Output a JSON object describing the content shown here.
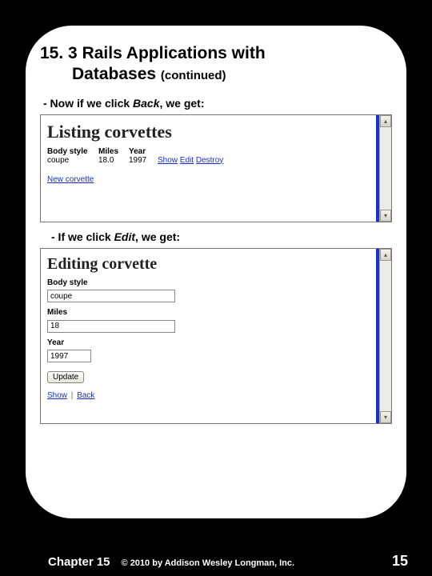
{
  "heading": {
    "section_num": "15. 3",
    "title_rest": "Rails Applications with",
    "title_line2": "Databases",
    "continued": "(continued)"
  },
  "bullet1_pre": "- Now if we click ",
  "bullet1_em": "Back",
  "bullet1_post": ", we get:",
  "bullet2_pre": "- If we click ",
  "bullet2_em": "Edit",
  "bullet2_post": ", we get:",
  "listing": {
    "title": "Listing corvettes",
    "headers": {
      "body_style": "Body style",
      "miles": "Miles",
      "year": "Year"
    },
    "row": {
      "body_style": "coupe",
      "miles": "18.0",
      "year": "1997",
      "show": "Show",
      "edit": "Edit",
      "destroy": "Destroy"
    },
    "new_link": "New corvette"
  },
  "editing": {
    "title": "Editing corvette",
    "labels": {
      "body_style": "Body style",
      "miles": "Miles",
      "year": "Year"
    },
    "values": {
      "body_style": "coupe",
      "miles": "18",
      "year": "1997"
    },
    "update_btn": "Update",
    "show": "Show",
    "back": "Back"
  },
  "scrollbar": {
    "up": "▴",
    "down": "▾"
  },
  "footer": {
    "chapter": "Chapter 15",
    "copyright": "© 2010 by Addison Wesley Longman, Inc.",
    "page": "15"
  }
}
